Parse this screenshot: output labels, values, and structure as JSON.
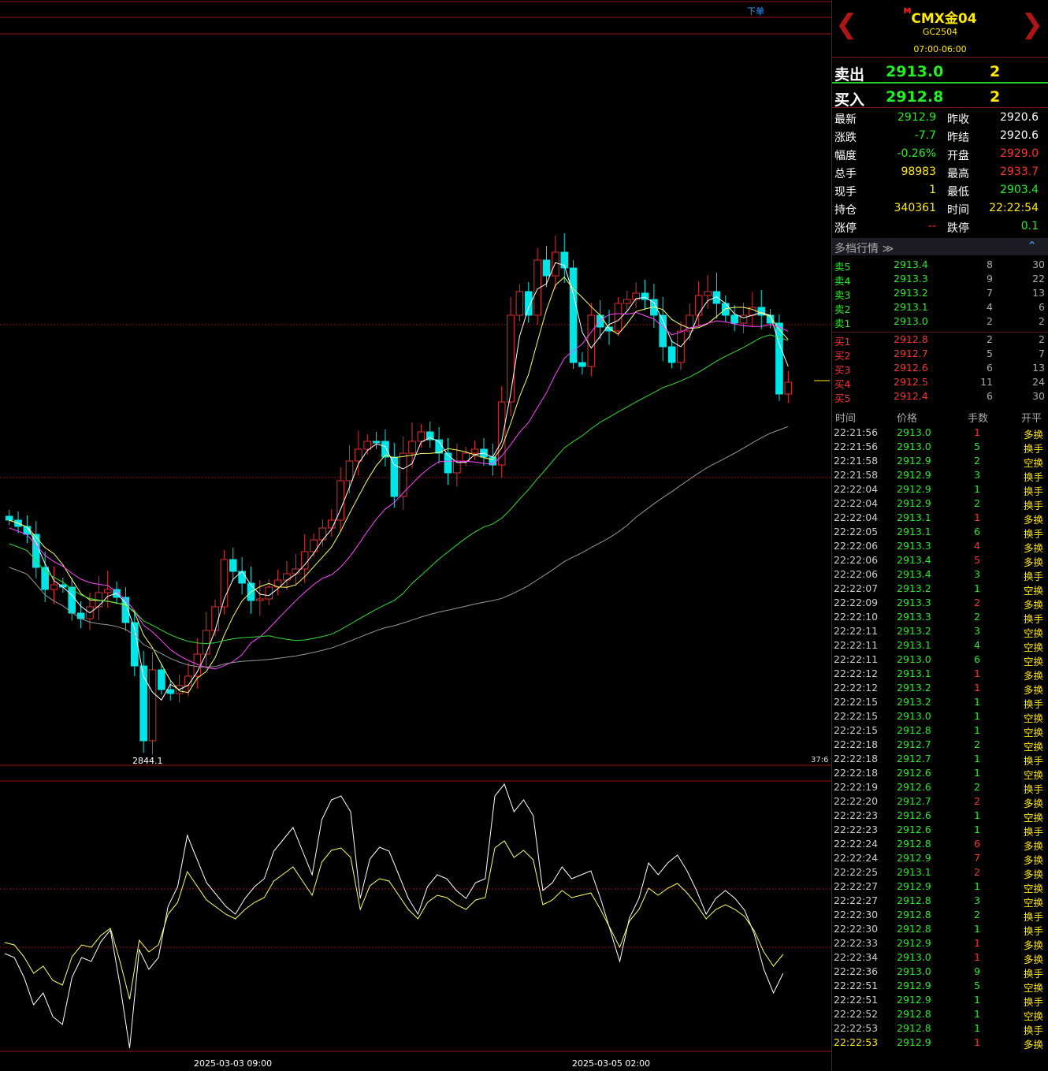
{
  "chart": {
    "order_button": "下单",
    "low_price_label": "2844.1",
    "right_value_label": "37:6",
    "date_labels": [
      "2025-03-03 09:00",
      "2025-03-05 02:00"
    ],
    "colors": {
      "up": "#e03030",
      "down": "#00e5e5",
      "ma_fast": "#ffffff",
      "ma_mid": "#ffff66",
      "ma_purple": "#ff44ff",
      "ma_green": "#33dd33",
      "ma_gray": "#999999"
    }
  },
  "header": {
    "prev_icon": "chevron-left-icon",
    "next_icon": "chevron-right-icon",
    "title_mark": "M",
    "title": "CMX金04",
    "code": "GC2504",
    "session": "07:00-06:00"
  },
  "quote": {
    "sell_label": "卖出",
    "sell_price": "2913.0",
    "sell_vol": "2",
    "buy_label": "买入",
    "buy_price": "2912.8",
    "buy_vol": "2"
  },
  "stats": [
    {
      "l1": "最新",
      "v1": "2912.9",
      "c1": "#22ee22",
      "l2": "昨收",
      "v2": "2920.6",
      "c2": "#ffffff"
    },
    {
      "l1": "涨跌",
      "v1": "-7.7",
      "c1": "#22ee22",
      "l2": "昨结",
      "v2": "2920.6",
      "c2": "#ffffff"
    },
    {
      "l1": "幅度",
      "v1": "-0.26%",
      "c1": "#22ee22",
      "l2": "开盘",
      "v2": "2929.0",
      "c2": "#ff3030"
    },
    {
      "l1": "总手",
      "v1": "98983",
      "c1": "#ffea00",
      "l2": "最高",
      "v2": "2933.7",
      "c2": "#ff3030"
    },
    {
      "l1": "现手",
      "v1": "1",
      "c1": "#ffea00",
      "l2": "最低",
      "v2": "2903.4",
      "c2": "#22ee22"
    },
    {
      "l1": "持仓",
      "v1": "340361",
      "c1": "#ffea00",
      "l2": "时间",
      "v2": "22:22:54",
      "c2": "#ffea00"
    },
    {
      "l1": "涨停",
      "v1": "--",
      "c1": "#ff3030",
      "l2": "跌停",
      "v2": "0.1",
      "c2": "#22ee22"
    }
  ],
  "depth": {
    "title": "多档行情 ≫",
    "toggle_icon": "chevron-up-icon",
    "asks": [
      {
        "label": "卖5",
        "price": "2913.4",
        "vol": "8",
        "total": "30"
      },
      {
        "label": "卖4",
        "price": "2913.3",
        "vol": "9",
        "total": "22"
      },
      {
        "label": "卖3",
        "price": "2913.2",
        "vol": "7",
        "total": "13"
      },
      {
        "label": "卖2",
        "price": "2913.1",
        "vol": "4",
        "total": "6"
      },
      {
        "label": "卖1",
        "price": "2913.0",
        "vol": "2",
        "total": "2"
      }
    ],
    "bids": [
      {
        "label": "买1",
        "price": "2912.8",
        "vol": "2",
        "total": "2"
      },
      {
        "label": "买2",
        "price": "2912.7",
        "vol": "5",
        "total": "7"
      },
      {
        "label": "买3",
        "price": "2912.6",
        "vol": "6",
        "total": "13"
      },
      {
        "label": "买4",
        "price": "2912.5",
        "vol": "11",
        "total": "24"
      },
      {
        "label": "买5",
        "price": "2912.4",
        "vol": "6",
        "total": "30"
      }
    ]
  },
  "ticks_header": {
    "time": "时间",
    "price": "价格",
    "vol": "手数",
    "type": "开平"
  },
  "ticks": [
    {
      "time": "22:21:56",
      "price": "2913.0",
      "vol": "1",
      "type": "多换",
      "vc": "#ff3030"
    },
    {
      "time": "22:21:56",
      "price": "2913.0",
      "vol": "5",
      "type": "换手",
      "vc": "#22ee22"
    },
    {
      "time": "22:21:58",
      "price": "2912.9",
      "vol": "2",
      "type": "空换",
      "vc": "#22ee22"
    },
    {
      "time": "22:21:58",
      "price": "2912.9",
      "vol": "3",
      "type": "换手",
      "vc": "#22ee22"
    },
    {
      "time": "22:22:04",
      "price": "2912.9",
      "vol": "1",
      "type": "换手",
      "vc": "#22ee22"
    },
    {
      "time": "22:22:04",
      "price": "2912.9",
      "vol": "2",
      "type": "换手",
      "vc": "#22ee22"
    },
    {
      "time": "22:22:04",
      "price": "2913.1",
      "vol": "1",
      "type": "多换",
      "vc": "#ff3030"
    },
    {
      "time": "22:22:05",
      "price": "2913.1",
      "vol": "6",
      "type": "换手",
      "vc": "#22ee22"
    },
    {
      "time": "22:22:06",
      "price": "2913.3",
      "vol": "4",
      "type": "多换",
      "vc": "#ff3030"
    },
    {
      "time": "22:22:06",
      "price": "2913.4",
      "vol": "5",
      "type": "多换",
      "vc": "#ff3030"
    },
    {
      "time": "22:22:06",
      "price": "2913.4",
      "vol": "3",
      "type": "换手",
      "vc": "#22ee22"
    },
    {
      "time": "22:22:07",
      "price": "2913.2",
      "vol": "1",
      "type": "空换",
      "vc": "#22ee22"
    },
    {
      "time": "22:22:09",
      "price": "2913.3",
      "vol": "2",
      "type": "多换",
      "vc": "#ff3030"
    },
    {
      "time": "22:22:10",
      "price": "2913.3",
      "vol": "2",
      "type": "换手",
      "vc": "#22ee22"
    },
    {
      "time": "22:22:11",
      "price": "2913.2",
      "vol": "3",
      "type": "空换",
      "vc": "#22ee22"
    },
    {
      "time": "22:22:11",
      "price": "2913.1",
      "vol": "4",
      "type": "空换",
      "vc": "#22ee22"
    },
    {
      "time": "22:22:11",
      "price": "2913.0",
      "vol": "6",
      "type": "空换",
      "vc": "#22ee22"
    },
    {
      "time": "22:22:12",
      "price": "2913.1",
      "vol": "1",
      "type": "多换",
      "vc": "#ff3030"
    },
    {
      "time": "22:22:12",
      "price": "2913.2",
      "vol": "1",
      "type": "多换",
      "vc": "#ff3030"
    },
    {
      "time": "22:22:15",
      "price": "2913.2",
      "vol": "1",
      "type": "换手",
      "vc": "#22ee22"
    },
    {
      "time": "22:22:15",
      "price": "2913.0",
      "vol": "1",
      "type": "空换",
      "vc": "#22ee22"
    },
    {
      "time": "22:22:15",
      "price": "2912.8",
      "vol": "1",
      "type": "空换",
      "vc": "#22ee22"
    },
    {
      "time": "22:22:18",
      "price": "2912.7",
      "vol": "2",
      "type": "空换",
      "vc": "#22ee22"
    },
    {
      "time": "22:22:18",
      "price": "2912.7",
      "vol": "1",
      "type": "换手",
      "vc": "#22ee22"
    },
    {
      "time": "22:22:18",
      "price": "2912.6",
      "vol": "1",
      "type": "空换",
      "vc": "#22ee22"
    },
    {
      "time": "22:22:19",
      "price": "2912.6",
      "vol": "2",
      "type": "换手",
      "vc": "#22ee22"
    },
    {
      "time": "22:22:20",
      "price": "2912.7",
      "vol": "2",
      "type": "多换",
      "vc": "#ff3030"
    },
    {
      "time": "22:22:23",
      "price": "2912.6",
      "vol": "1",
      "type": "空换",
      "vc": "#22ee22"
    },
    {
      "time": "22:22:23",
      "price": "2912.6",
      "vol": "1",
      "type": "换手",
      "vc": "#22ee22"
    },
    {
      "time": "22:22:24",
      "price": "2912.8",
      "vol": "6",
      "type": "多换",
      "vc": "#ff3030"
    },
    {
      "time": "22:22:24",
      "price": "2912.9",
      "vol": "7",
      "type": "多换",
      "vc": "#ff3030"
    },
    {
      "time": "22:22:25",
      "price": "2913.1",
      "vol": "2",
      "type": "多换",
      "vc": "#ff3030"
    },
    {
      "time": "22:22:27",
      "price": "2912.9",
      "vol": "1",
      "type": "空换",
      "vc": "#22ee22"
    },
    {
      "time": "22:22:27",
      "price": "2912.8",
      "vol": "3",
      "type": "空换",
      "vc": "#22ee22"
    },
    {
      "time": "22:22:30",
      "price": "2912.8",
      "vol": "2",
      "type": "换手",
      "vc": "#22ee22"
    },
    {
      "time": "22:22:30",
      "price": "2912.8",
      "vol": "1",
      "type": "换手",
      "vc": "#22ee22"
    },
    {
      "time": "22:22:33",
      "price": "2912.9",
      "vol": "1",
      "type": "多换",
      "vc": "#ff3030"
    },
    {
      "time": "22:22:34",
      "price": "2913.0",
      "vol": "1",
      "type": "多换",
      "vc": "#ff3030"
    },
    {
      "time": "22:22:36",
      "price": "2913.0",
      "vol": "9",
      "type": "换手",
      "vc": "#22ee22"
    },
    {
      "time": "22:22:51",
      "price": "2912.9",
      "vol": "5",
      "type": "空换",
      "vc": "#22ee22"
    },
    {
      "time": "22:22:51",
      "price": "2912.9",
      "vol": "1",
      "type": "换手",
      "vc": "#22ee22"
    },
    {
      "time": "22:22:52",
      "price": "2912.8",
      "vol": "1",
      "type": "空换",
      "vc": "#22ee22"
    },
    {
      "time": "22:22:53",
      "price": "2912.8",
      "vol": "1",
      "type": "换手",
      "vc": "#22ee22"
    },
    {
      "time": "22:22:53",
      "price": "2912.9",
      "vol": "1",
      "type": "多换",
      "vc": "#ff3030"
    }
  ]
}
